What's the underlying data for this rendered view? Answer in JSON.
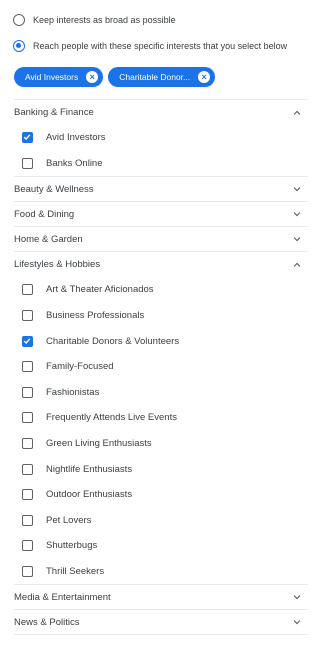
{
  "options": {
    "broad": {
      "label": "Keep interests as broad as possible",
      "selected": false
    },
    "specific": {
      "label": "Reach people with these specific interests that you select below",
      "selected": true
    }
  },
  "chips": [
    {
      "label": "Avid Investors"
    },
    {
      "label": "Charitable Donor..."
    }
  ],
  "categories": [
    {
      "label": "Banking & Finance",
      "expanded": true,
      "items": [
        {
          "label": "Avid Investors",
          "checked": true
        },
        {
          "label": "Banks Online",
          "checked": false
        }
      ]
    },
    {
      "label": "Beauty & Wellness",
      "expanded": false,
      "items": []
    },
    {
      "label": "Food & Dining",
      "expanded": false,
      "items": []
    },
    {
      "label": "Home & Garden",
      "expanded": false,
      "items": []
    },
    {
      "label": "Lifestyles & Hobbies",
      "expanded": true,
      "items": [
        {
          "label": "Art & Theater Aficionados",
          "checked": false
        },
        {
          "label": "Business Professionals",
          "checked": false
        },
        {
          "label": "Charitable Donors & Volunteers",
          "checked": true
        },
        {
          "label": "Family-Focused",
          "checked": false
        },
        {
          "label": "Fashionistas",
          "checked": false
        },
        {
          "label": "Frequently Attends Live Events",
          "checked": false
        },
        {
          "label": "Green Living Enthusiasts",
          "checked": false
        },
        {
          "label": "Nightlife Enthusiasts",
          "checked": false
        },
        {
          "label": "Outdoor Enthusiasts",
          "checked": false
        },
        {
          "label": "Pet Lovers",
          "checked": false
        },
        {
          "label": "Shutterbugs",
          "checked": false
        },
        {
          "label": "Thrill Seekers",
          "checked": false
        }
      ]
    },
    {
      "label": "Media & Entertainment",
      "expanded": false,
      "items": []
    },
    {
      "label": "News & Politics",
      "expanded": false,
      "items": []
    }
  ],
  "colors": {
    "accent": "#1a73e8",
    "text": "#3c4043",
    "divider": "#e8eaed"
  }
}
